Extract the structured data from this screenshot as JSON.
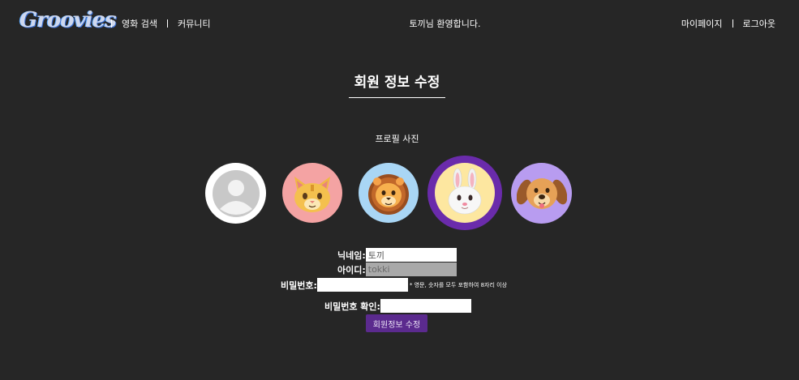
{
  "header": {
    "logo_text": "Groovies",
    "nav_left": [
      "영화 검색",
      "커뮤니티"
    ],
    "greeting": "토끼님 환영합니다.",
    "nav_right": [
      "마이페이지",
      "로그아웃"
    ]
  },
  "page": {
    "title": "회원 정보 수정",
    "profile_label": "프로필 사진",
    "avatars": [
      {
        "name": "default-avatar",
        "bg": "#ffffff",
        "selected": false
      },
      {
        "name": "cat-avatar",
        "bg": "#f4a3a3",
        "selected": false
      },
      {
        "name": "lion-avatar",
        "bg": "#a9d6f5",
        "selected": false
      },
      {
        "name": "rabbit-avatar",
        "bg": "#fde7a0",
        "selected": true
      },
      {
        "name": "dog-avatar",
        "bg": "#b89cf0",
        "selected": false
      }
    ],
    "selected_ring_color": "#6a2bab"
  },
  "form": {
    "nickname": {
      "label": "닉네임:",
      "value": "토끼"
    },
    "user_id": {
      "label": "아이디:",
      "value": "tokki"
    },
    "password": {
      "label": "비밀번호:",
      "value": "",
      "hint": "* 영문, 숫자를 모두 포함하여 8자리 이상"
    },
    "password_confirm": {
      "label": "비밀번호 확인:",
      "value": ""
    },
    "submit_label": "회원정보 수정"
  }
}
